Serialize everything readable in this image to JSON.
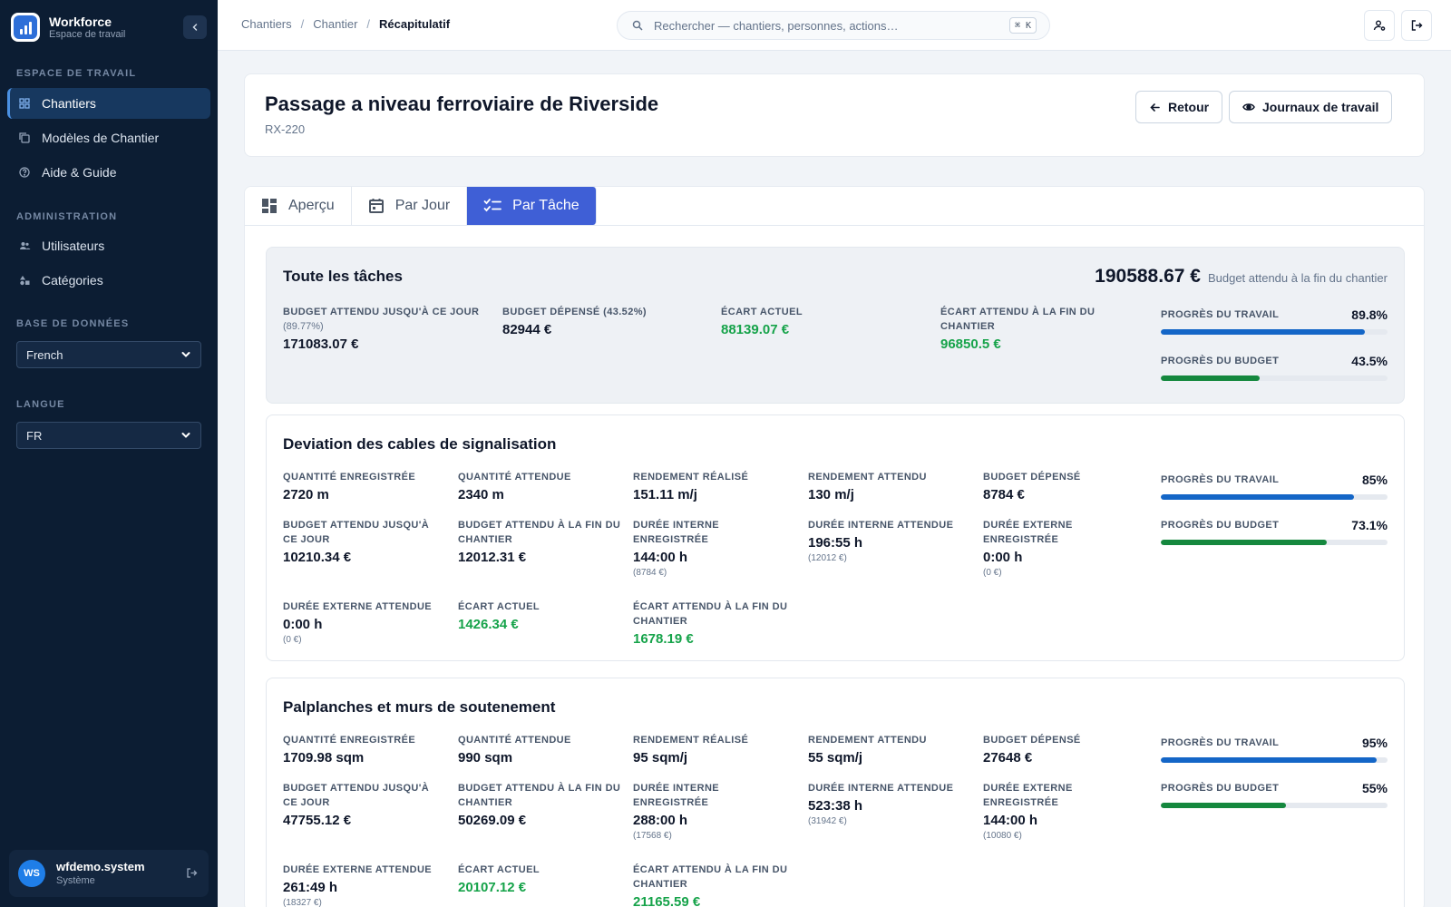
{
  "app": {
    "name": "Workforce",
    "subtitle": "Espace de travail"
  },
  "sidebar": {
    "section_workspace": "ESPACE DE TRAVAIL",
    "items_workspace": [
      {
        "label": "Chantiers",
        "icon": "grid-icon"
      },
      {
        "label": "Modèles de Chantier",
        "icon": "template-icon"
      },
      {
        "label": "Aide & Guide",
        "icon": "help-icon"
      }
    ],
    "section_admin": "ADMINISTRATION",
    "items_admin": [
      {
        "label": "Utilisateurs",
        "icon": "users-icon"
      },
      {
        "label": "Catégories",
        "icon": "shapes-icon"
      }
    ],
    "section_db": "BASE DE DONNÉES",
    "db_value": "French",
    "section_lang": "LANGUE",
    "lang_value": "FR",
    "user": {
      "initials": "WS",
      "name": "wfdemo.system",
      "role": "Système"
    }
  },
  "topbar": {
    "breadcrumb": [
      "Chantiers",
      "Chantier",
      "Récapitulatif"
    ],
    "search_placeholder": "Rechercher — chantiers, personnes, actions…",
    "shortcut": "⌘ K"
  },
  "header": {
    "title": "Passage a niveau ferroviaire de Riverside",
    "code": "RX-220",
    "back_label": "Retour",
    "logs_label": "Journaux de travail"
  },
  "tabs": [
    {
      "label": "Aperçu",
      "active": false
    },
    {
      "label": "Par Jour",
      "active": false
    },
    {
      "label": "Par Tâche",
      "active": true
    }
  ],
  "summary": {
    "title": "Toute les tâches",
    "total_amount": "190588.67 €",
    "total_label": "Budget attendu à la fin du chantier",
    "metrics": [
      {
        "label": "BUDGET ATTENDU JUSQU'À CE JOUR",
        "sub": "(89.77%)",
        "value": "171083.07 €",
        "green": false
      },
      {
        "label": "BUDGET DÉPENSÉ (43.52%)",
        "value": "82944 €",
        "green": false
      },
      {
        "label": "ÉCART ACTUEL",
        "value": "88139.07 €",
        "green": true
      },
      {
        "label": "ÉCART ATTENDU À LA FIN DU CHANTIER",
        "value": "96850.5 €",
        "green": true
      }
    ],
    "progress": [
      {
        "label": "PROGRÈS DU TRAVAIL",
        "value": "89.8%",
        "fraction": 0.898,
        "color": "blue"
      },
      {
        "label": "PROGRÈS DU BUDGET",
        "value": "43.5%",
        "fraction": 0.435,
        "color": "green"
      }
    ]
  },
  "tasks": [
    {
      "title": "Deviation des cables de signalisation",
      "rows": [
        [
          {
            "label": "QUANTITÉ ENREGISTRÉE",
            "value": "2720 m"
          },
          {
            "label": "QUANTITÉ ATTENDUE",
            "value": "2340 m"
          },
          {
            "label": "RENDEMENT RÉALISÉ",
            "value": "151.11 m/j"
          },
          {
            "label": "RENDEMENT ATTENDU",
            "value": "130 m/j"
          },
          {
            "label": "BUDGET DÉPENSÉ",
            "value": "8784 €"
          }
        ],
        [
          {
            "label": "BUDGET ATTENDU JUSQU'À CE JOUR",
            "value": "10210.34 €"
          },
          {
            "label": "BUDGET ATTENDU À LA FIN DU CHANTIER",
            "value": "12012.31 €"
          },
          {
            "label": "DURÉE INTERNE ENREGISTRÉE",
            "value": "144:00 h",
            "note": "(8784 €)"
          },
          {
            "label": "DURÉE INTERNE ATTENDUE",
            "value": "196:55 h",
            "note": "(12012 €)"
          },
          {
            "label": "DURÉE EXTERNE ENREGISTRÉE",
            "value": "0:00 h",
            "note": "(0 €)"
          }
        ],
        [
          {
            "label": "DURÉE EXTERNE ATTENDUE",
            "value": "0:00 h",
            "note": "(0 €)"
          },
          {
            "label": "ÉCART ACTUEL",
            "value": "1426.34 €",
            "green": true
          },
          {
            "label": "ÉCART ATTENDU À LA FIN DU CHANTIER",
            "value": "1678.19 €",
            "green": true
          }
        ]
      ],
      "progress": [
        {
          "label": "PROGRÈS DU TRAVAIL",
          "value": "85%",
          "fraction": 0.85,
          "color": "blue"
        },
        {
          "label": "PROGRÈS DU BUDGET",
          "value": "73.1%",
          "fraction": 0.731,
          "color": "green"
        }
      ]
    },
    {
      "title": "Palplanches et murs de soutenement",
      "rows": [
        [
          {
            "label": "QUANTITÉ ENREGISTRÉE",
            "value": "1709.98 sqm"
          },
          {
            "label": "QUANTITÉ ATTENDUE",
            "value": "990 sqm"
          },
          {
            "label": "RENDEMENT RÉALISÉ",
            "value": "95 sqm/j"
          },
          {
            "label": "RENDEMENT ATTENDU",
            "value": "55 sqm/j"
          },
          {
            "label": "BUDGET DÉPENSÉ",
            "value": "27648 €"
          }
        ],
        [
          {
            "label": "BUDGET ATTENDU JUSQU'À CE JOUR",
            "value": "47755.12 €"
          },
          {
            "label": "BUDGET ATTENDU À LA FIN DU CHANTIER",
            "value": "50269.09 €"
          },
          {
            "label": "DURÉE INTERNE ENREGISTRÉE",
            "value": "288:00 h",
            "note": "(17568 €)"
          },
          {
            "label": "DURÉE INTERNE ATTENDUE",
            "value": "523:38 h",
            "note": "(31942 €)"
          },
          {
            "label": "DURÉE EXTERNE ENREGISTRÉE",
            "value": "144:00 h",
            "note": "(10080 €)"
          }
        ],
        [
          {
            "label": "DURÉE EXTERNE ATTENDUE",
            "value": "261:49 h",
            "note": "(18327 €)"
          },
          {
            "label": "ÉCART ACTUEL",
            "value": "20107.12 €",
            "green": true
          },
          {
            "label": "ÉCART ATTENDU À LA FIN DU CHANTIER",
            "value": "21165.59 €",
            "green": true
          }
        ]
      ],
      "progress": [
        {
          "label": "PROGRÈS DU TRAVAIL",
          "value": "95%",
          "fraction": 0.95,
          "color": "blue"
        },
        {
          "label": "PROGRÈS DU BUDGET",
          "value": "55%",
          "fraction": 0.55,
          "color": "green"
        }
      ]
    }
  ]
}
